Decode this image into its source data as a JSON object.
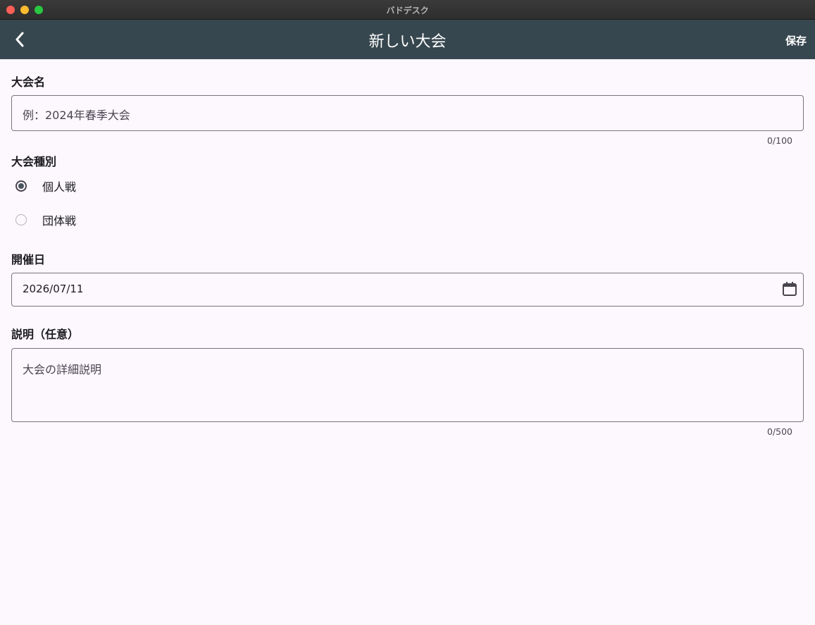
{
  "window": {
    "title": "バドデスク"
  },
  "appbar": {
    "back_icon": "chevron-left-icon",
    "title": "新しい大会",
    "save_label": "保存"
  },
  "form": {
    "name": {
      "label": "大会名",
      "placeholder": "例：2024年春季大会",
      "value": "",
      "counter": "0/100"
    },
    "type": {
      "label": "大会種別",
      "options": [
        {
          "label": "個人戦",
          "selected": true
        },
        {
          "label": "団体戦",
          "selected": false
        }
      ]
    },
    "date": {
      "label": "開催日",
      "value": "2026/07/11",
      "icon": "calendar-icon"
    },
    "description": {
      "label": "説明（任意）",
      "placeholder": "大会の詳細説明",
      "value": "",
      "counter": "0/500"
    }
  },
  "colors": {
    "appbar": "#37474f",
    "background": "#fdf7fe",
    "outline": "#79747e"
  }
}
